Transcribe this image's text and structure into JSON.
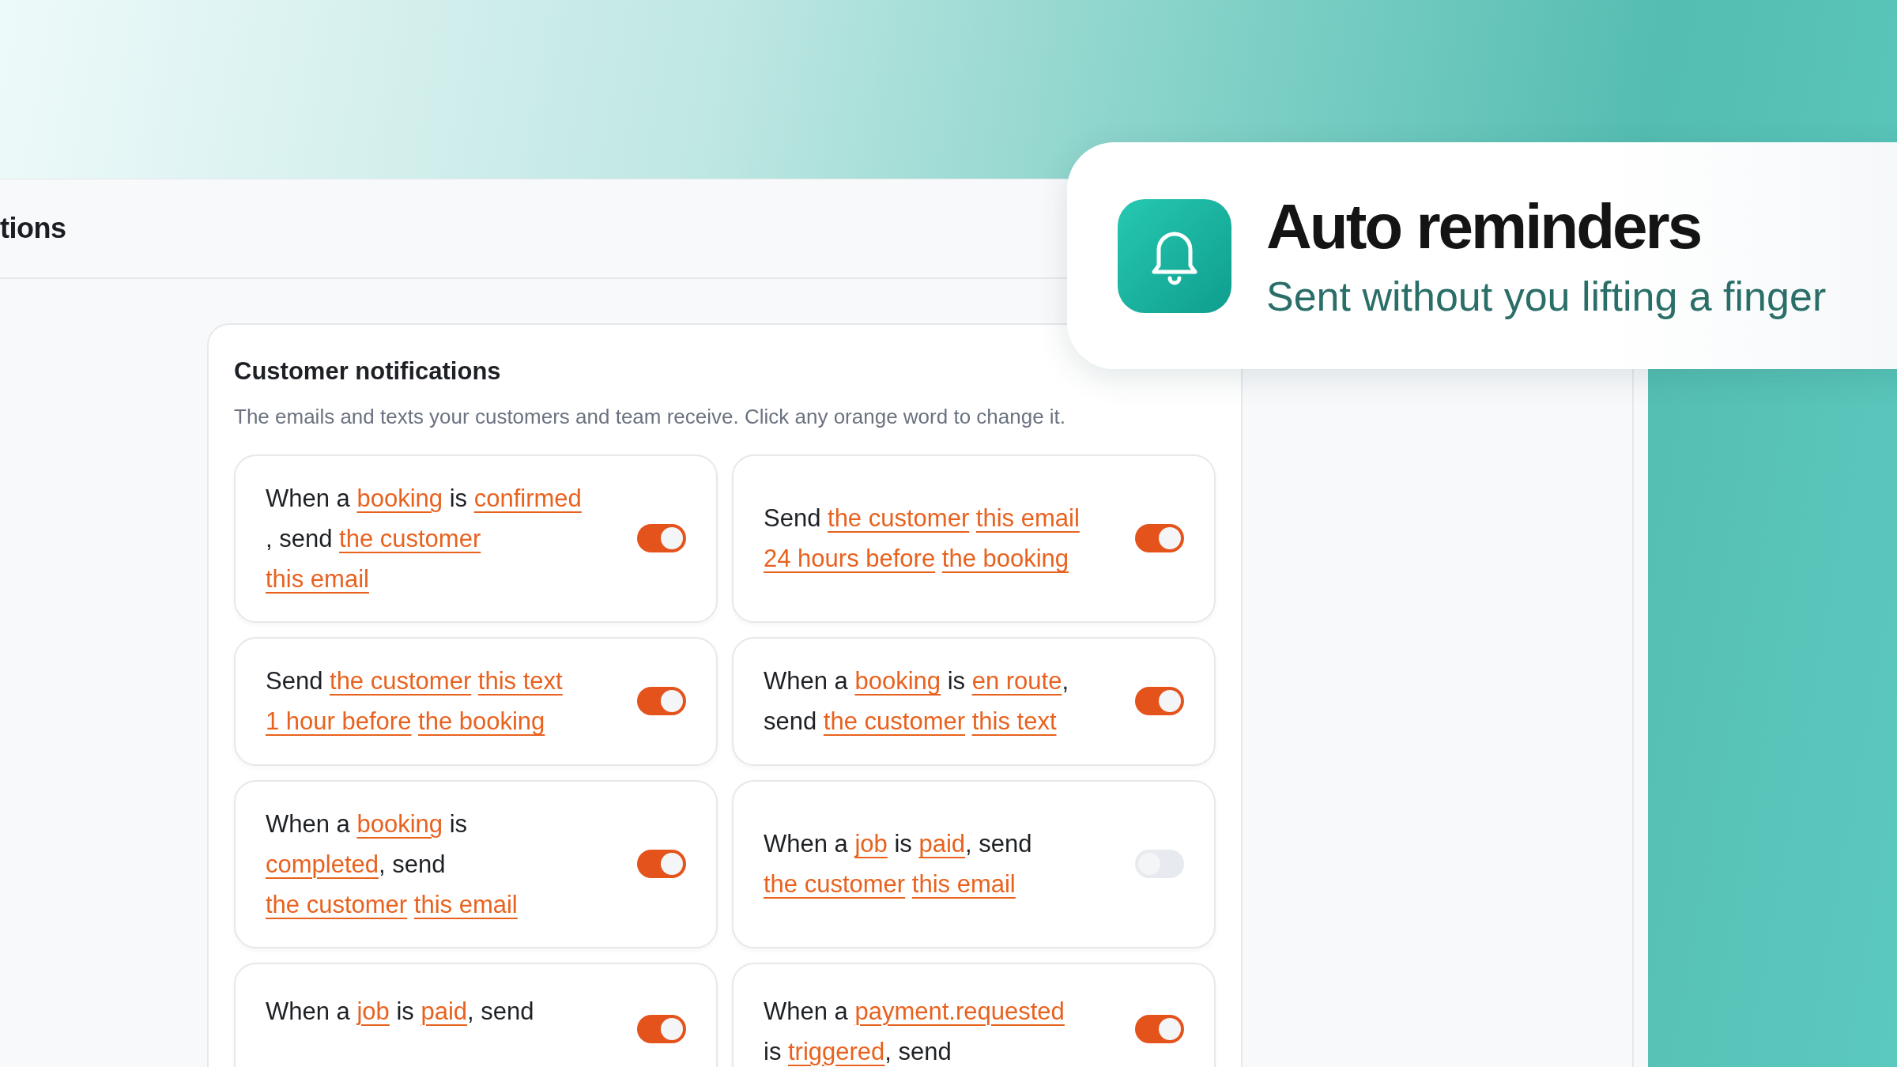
{
  "app": {
    "header_title": "tions",
    "section": {
      "title": "Customer notifications",
      "description": "The emails and texts your customers and team receive. Click any orange word to change it.",
      "rules": [
        {
          "on": true,
          "lines": [
            [
              {
                "kind": "plain",
                "text": "When a "
              },
              {
                "kind": "link",
                "text": "booking"
              },
              {
                "kind": "plain",
                "text": " is "
              },
              {
                "kind": "link",
                "text": "confirmed"
              }
            ],
            [
              {
                "kind": "plain",
                "text": ", send "
              },
              {
                "kind": "link",
                "text": "the customer"
              }
            ],
            [
              {
                "kind": "link",
                "text": "this email"
              }
            ]
          ]
        },
        {
          "on": true,
          "lines": [
            [
              {
                "kind": "plain",
                "text": "Send "
              },
              {
                "kind": "link",
                "text": "the customer"
              },
              {
                "kind": "gap"
              },
              {
                "kind": "link",
                "text": "this email"
              }
            ],
            [
              {
                "kind": "link",
                "text": "24 hours before"
              },
              {
                "kind": "gap"
              },
              {
                "kind": "link",
                "text": "the booking"
              }
            ]
          ]
        },
        {
          "on": true,
          "lines": [
            [
              {
                "kind": "plain",
                "text": "Send "
              },
              {
                "kind": "link",
                "text": "the customer"
              },
              {
                "kind": "gap"
              },
              {
                "kind": "link",
                "text": "this text"
              }
            ],
            [
              {
                "kind": "link",
                "text": "1 hour before"
              },
              {
                "kind": "gap"
              },
              {
                "kind": "link",
                "text": "the booking"
              }
            ]
          ]
        },
        {
          "on": true,
          "lines": [
            [
              {
                "kind": "plain",
                "text": "When a "
              },
              {
                "kind": "link",
                "text": "booking"
              },
              {
                "kind": "plain",
                "text": " is "
              },
              {
                "kind": "link",
                "text": "en route"
              },
              {
                "kind": "plain",
                "text": ","
              }
            ],
            [
              {
                "kind": "plain",
                "text": "send "
              },
              {
                "kind": "link",
                "text": "the customer"
              },
              {
                "kind": "gap"
              },
              {
                "kind": "link",
                "text": "this text"
              }
            ]
          ]
        },
        {
          "on": true,
          "lines": [
            [
              {
                "kind": "plain",
                "text": "When a "
              },
              {
                "kind": "link",
                "text": "booking"
              },
              {
                "kind": "plain",
                "text": " is"
              }
            ],
            [
              {
                "kind": "link",
                "text": "completed"
              },
              {
                "kind": "plain",
                "text": ", send"
              }
            ],
            [
              {
                "kind": "link",
                "text": "the customer"
              },
              {
                "kind": "gap"
              },
              {
                "kind": "link",
                "text": "this email"
              }
            ]
          ]
        },
        {
          "on": false,
          "lines": [
            [
              {
                "kind": "plain",
                "text": "When a "
              },
              {
                "kind": "link",
                "text": "job"
              },
              {
                "kind": "plain",
                "text": " is "
              },
              {
                "kind": "link",
                "text": "paid"
              },
              {
                "kind": "plain",
                "text": ", send"
              }
            ],
            [
              {
                "kind": "link",
                "text": "the customer"
              },
              {
                "kind": "gap"
              },
              {
                "kind": "link",
                "text": "this email"
              }
            ]
          ]
        },
        {
          "on": true,
          "lines": [
            [
              {
                "kind": "plain",
                "text": "When a "
              },
              {
                "kind": "link",
                "text": "job"
              },
              {
                "kind": "plain",
                "text": " is "
              },
              {
                "kind": "link",
                "text": "paid"
              },
              {
                "kind": "plain",
                "text": ", send"
              }
            ]
          ]
        },
        {
          "on": true,
          "lines": [
            [
              {
                "kind": "plain",
                "text": "When a "
              },
              {
                "kind": "link",
                "text": "payment.requested"
              }
            ],
            [
              {
                "kind": "plain",
                "text": "is "
              },
              {
                "kind": "link",
                "text": "triggered"
              },
              {
                "kind": "plain",
                "text": ", send"
              }
            ]
          ]
        }
      ]
    }
  },
  "callout": {
    "title": "Auto reminders",
    "subtitle": "Sent without you lifting a finger"
  }
}
